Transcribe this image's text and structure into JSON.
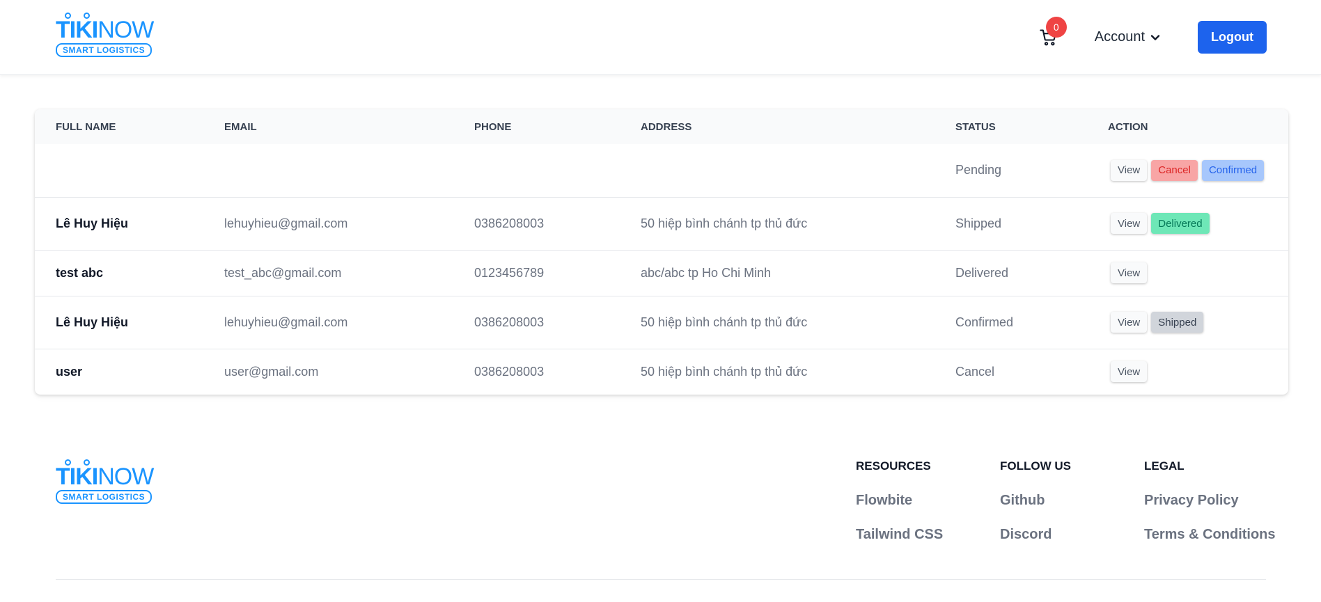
{
  "header": {
    "logo": {
      "main_bold": "TIKI",
      "main_light": "NOW",
      "tagline": "SMART LOGISTICS"
    },
    "cart": {
      "icon": "cart-icon",
      "count": "0"
    },
    "account_label": "Account",
    "logout_label": "Logout"
  },
  "table": {
    "columns": [
      "Full Name",
      "Email",
      "Phone",
      "Address",
      "Status",
      "Action"
    ],
    "rows": [
      {
        "name": "",
        "email": "",
        "phone": "",
        "address": "",
        "status": "Pending",
        "actions": [
          "View",
          "Cancel",
          "Confirmed"
        ]
      },
      {
        "name": "Lê Huy Hiệu",
        "email": "lehuyhieu@gmail.com",
        "phone": "0386208003",
        "address": "50 hiệp bình chánh tp thủ đức",
        "status": "Shipped",
        "actions": [
          "View",
          "Delivered"
        ]
      },
      {
        "name": "test abc",
        "email": "test_abc@gmail.com",
        "phone": "0123456789",
        "address": "abc/abc tp Ho Chi Minh",
        "status": "Delivered",
        "actions": [
          "View"
        ]
      },
      {
        "name": "Lê Huy Hiệu",
        "email": "lehuyhieu@gmail.com",
        "phone": "0386208003",
        "address": "50 hiệp bình chánh tp thủ đức",
        "status": "Confirmed",
        "actions": [
          "View",
          "Shipped"
        ]
      },
      {
        "name": "user",
        "email": "user@gmail.com",
        "phone": "0386208003",
        "address": "50 hiệp bình chánh tp thủ đức",
        "status": "Cancel",
        "actions": [
          "View"
        ]
      }
    ]
  },
  "footer": {
    "logo": {
      "main_bold": "TIKI",
      "main_light": "NOW",
      "tagline": "SMART LOGISTICS"
    },
    "columns": [
      {
        "title": "Resources",
        "links": [
          "Flowbite",
          "Tailwind CSS"
        ]
      },
      {
        "title": "Follow us",
        "links": [
          "Github",
          "Discord"
        ]
      },
      {
        "title": "Legal",
        "links": [
          "Privacy Policy",
          "Terms & Conditions"
        ]
      }
    ]
  },
  "colors": {
    "brand": "#1a94ff",
    "primary_button": "#1d63ed",
    "badge": "#ef4444",
    "cancel_bg": "#f8a5a5",
    "confirmed_bg": "#a7c7fc",
    "delivered_bg": "#6ee7b7",
    "shipped_bg": "#d1d5db"
  }
}
